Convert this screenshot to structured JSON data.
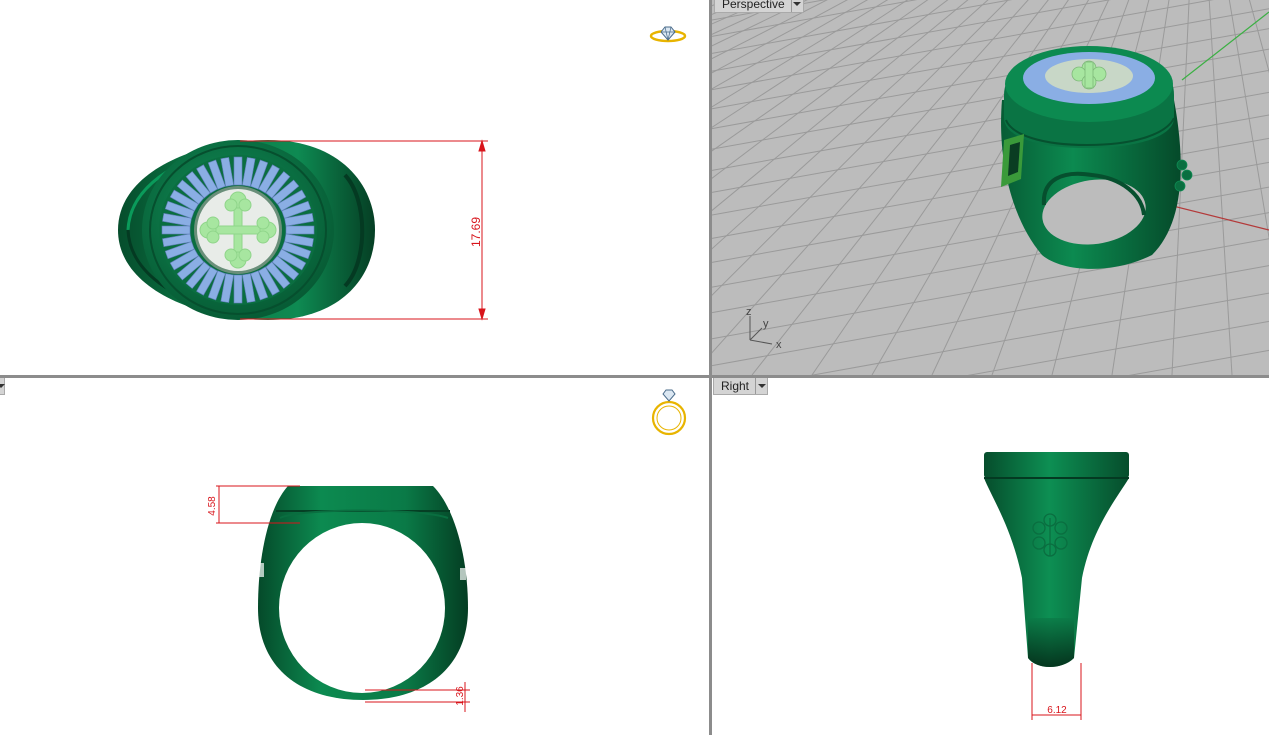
{
  "viewports": {
    "top": {
      "dimension": "17.69"
    },
    "perspective": {
      "label": "Perspective",
      "axes": {
        "x": "x",
        "y": "y",
        "z": "z"
      }
    },
    "front": {
      "dim_a": "4.58",
      "dim_b": "1.36"
    },
    "right": {
      "label": "Right",
      "dimension": "6.12"
    }
  },
  "colors": {
    "ring_green": "#0b7a47",
    "stones": "#8aaee4",
    "emblem": "#a7e6a0",
    "dimension_red": "#d8141b",
    "grid_bg": "#bcbcbc"
  },
  "icons": {
    "top_widget": "ring-diamond-side-icon",
    "front_widget": "ring-diamond-front-icon"
  }
}
